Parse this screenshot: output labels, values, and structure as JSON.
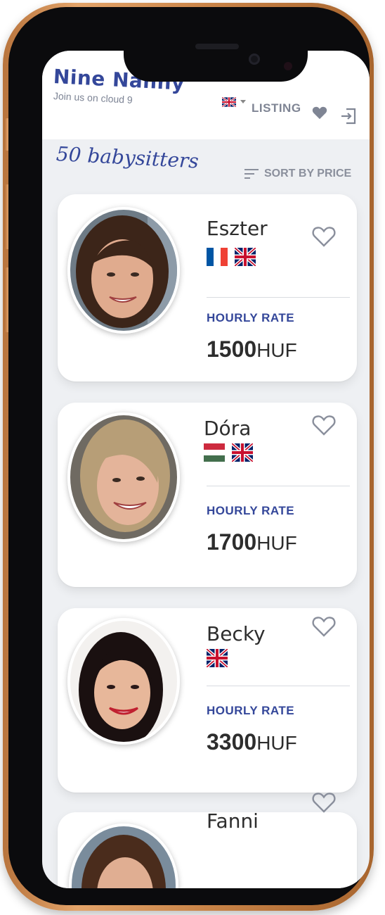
{
  "app": {
    "title": "Nine Nanny",
    "tagline": "Join us on cloud 9"
  },
  "nav": {
    "listing_label": "LISTING",
    "language": "uk-flag"
  },
  "listing": {
    "count_title": "50 babysitters",
    "sort_label": "SORT BY PRICE"
  },
  "rate_label": "HOURLY RATE",
  "babysitters": [
    {
      "name": "Eszter",
      "rate": "1500",
      "currency": "HUF",
      "languages": [
        "fr-flag",
        "uk-flag"
      ]
    },
    {
      "name": "Dóra",
      "rate": "1700",
      "currency": "HUF",
      "languages": [
        "hu-flag",
        "uk-flag"
      ]
    },
    {
      "name": "Becky",
      "rate": "3300",
      "currency": "HUF",
      "languages": [
        "uk-flag"
      ]
    },
    {
      "name": "Fanni",
      "languages": []
    }
  ],
  "colors": {
    "brand": "#34479a",
    "background": "#eef0f3",
    "card": "#ffffff",
    "frame_gold": "#d49255",
    "text": "#2d2d2d",
    "muted": "#7f8594"
  }
}
